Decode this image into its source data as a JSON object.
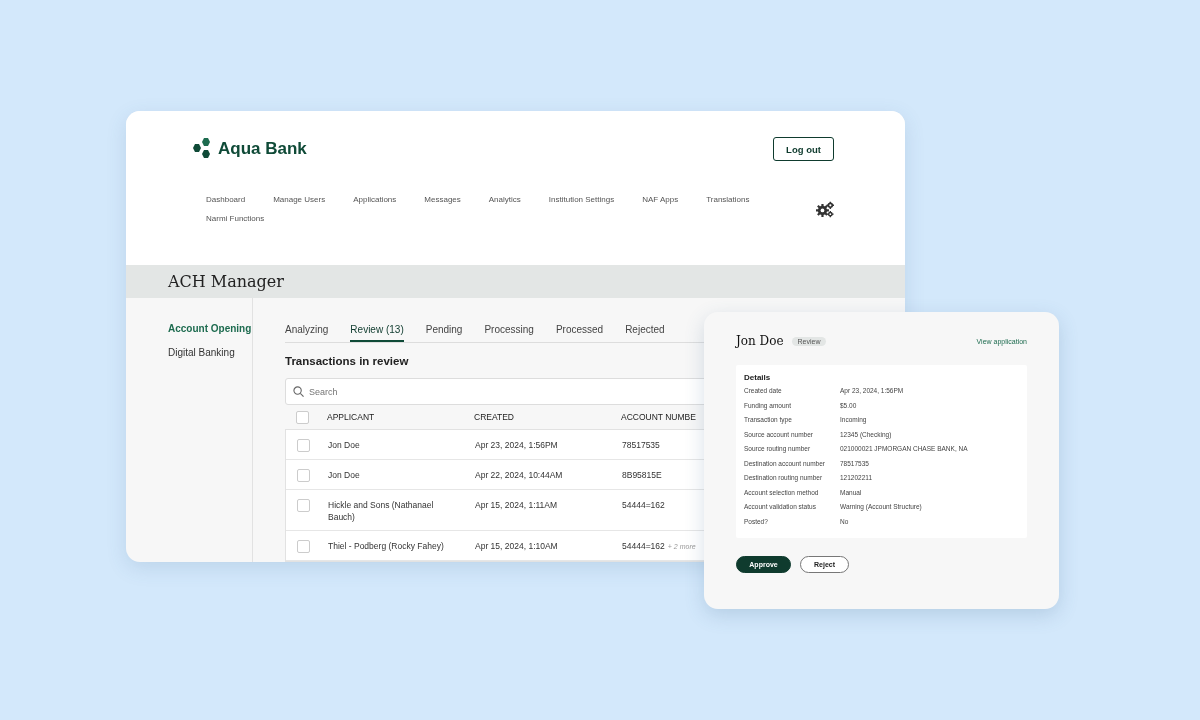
{
  "header": {
    "logo": "Aqua Bank",
    "logout": "Log out"
  },
  "nav": [
    {
      "label": "Dashboard"
    },
    {
      "label": "Manage Users"
    },
    {
      "label": "Applications"
    },
    {
      "label": "Messages"
    },
    {
      "label": "Analytics"
    },
    {
      "label": "Institution Settings"
    },
    {
      "label": "NAF Apps"
    },
    {
      "label": "Translations"
    },
    {
      "label": "Narmi Functions"
    }
  ],
  "page_title": "ACH Manager",
  "sidebar": {
    "items": [
      {
        "label": "Account Opening",
        "selected": true
      },
      {
        "label": "Digital Banking",
        "selected": false
      }
    ]
  },
  "tabs": [
    {
      "label": "Analyzing",
      "selected": false
    },
    {
      "label": "Review (13)",
      "selected": true
    },
    {
      "label": "Pending",
      "selected": false
    },
    {
      "label": "Processing",
      "selected": false
    },
    {
      "label": "Processed",
      "selected": false
    },
    {
      "label": "Rejected",
      "selected": false
    }
  ],
  "section_title": "Transactions in review",
  "search": {
    "placeholder": "Search"
  },
  "table": {
    "select_all_checked": false,
    "columns": [
      "APPLICANT",
      "CREATED",
      "ACCOUNT NUMBE"
    ],
    "rows": [
      {
        "applicant": "Jon Doe",
        "created": "Apr 23, 2024, 1:56PM",
        "account": "78517535",
        "checked": false
      },
      {
        "applicant": "Jon Doe",
        "created": "Apr 22, 2024, 10:44AM",
        "account": "8B95815E",
        "checked": false
      },
      {
        "applicant": "Hickle and Sons (Nathanael Bauch)",
        "created": "Apr 15, 2024, 1:11AM",
        "account": "54444=162",
        "checked": false
      },
      {
        "applicant": "Thiel - Podberg (Rocky Fahey)",
        "created": "Apr 15, 2024, 1:10AM",
        "account": "54444=162",
        "more": "+ 2 more",
        "checked": false
      }
    ]
  },
  "detail": {
    "name": "Jon Doe",
    "badge": "Review",
    "link": "View application",
    "section": "Details",
    "fields": [
      {
        "label": "Created date",
        "value": "Apr 23, 2024, 1:56PM"
      },
      {
        "label": "Funding amount",
        "value": "$5.00"
      },
      {
        "label": "Transaction type",
        "value": "Incoming"
      },
      {
        "label": "Source account number",
        "value": "12345 (Checking)"
      },
      {
        "label": "Source routing number",
        "value": "021000021 JPMORGAN CHASE BANK, NA"
      },
      {
        "label": "Destination account number",
        "value": "78517535"
      },
      {
        "label": "Destination routing number",
        "value": "121202211"
      },
      {
        "label": "Account selection method",
        "value": "Manual"
      },
      {
        "label": "Account validation status",
        "value": "Warning (Account Structure)"
      },
      {
        "label": "Posted?",
        "value": "No"
      }
    ],
    "approve": "Approve",
    "reject": "Reject"
  }
}
